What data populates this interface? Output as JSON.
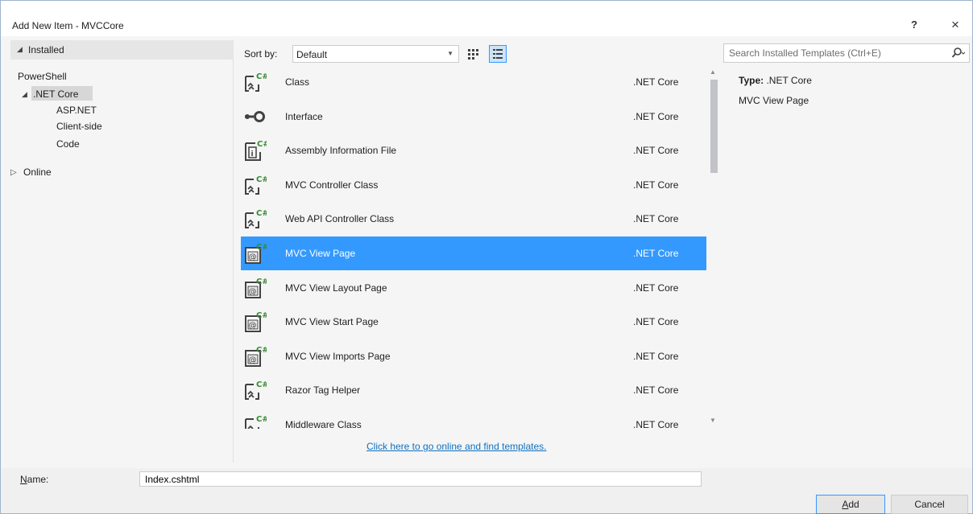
{
  "window": {
    "title": "Add New Item - MVCCore",
    "help_label": "?",
    "close_label": "×"
  },
  "tree": {
    "installed": "Installed",
    "installed_expanded_glyph": "◢",
    "items": [
      {
        "label": "PowerShell",
        "level": 1
      },
      {
        "label": ".NET Core",
        "level": 1,
        "selected": true,
        "expanded": true
      },
      {
        "label": "ASP.NET",
        "level": 2
      },
      {
        "label": "Client-side",
        "level": 2
      },
      {
        "label": "Code",
        "level": 2
      }
    ],
    "online": "Online",
    "online_glyph": "▷"
  },
  "toolbar": {
    "sort_label": "Sort by:",
    "sort_value": "Default"
  },
  "templates": [
    {
      "name": "Class",
      "type": ".NET Core",
      "icon": "csharp-class-icon"
    },
    {
      "name": "Interface",
      "type": ".NET Core",
      "icon": "interface-icon"
    },
    {
      "name": "Assembly Information File",
      "type": ".NET Core",
      "icon": "assembly-info-icon"
    },
    {
      "name": "MVC Controller Class",
      "type": ".NET Core",
      "icon": "csharp-class-icon"
    },
    {
      "name": "Web API Controller Class",
      "type": ".NET Core",
      "icon": "csharp-class-icon"
    },
    {
      "name": "MVC View Page",
      "type": ".NET Core",
      "icon": "razor-page-icon",
      "selected": true
    },
    {
      "name": "MVC View Layout Page",
      "type": ".NET Core",
      "icon": "razor-page-icon"
    },
    {
      "name": "MVC View Start Page",
      "type": ".NET Core",
      "icon": "razor-page-icon"
    },
    {
      "name": "MVC View Imports Page",
      "type": ".NET Core",
      "icon": "razor-page-icon"
    },
    {
      "name": "Razor Tag Helper",
      "type": ".NET Core",
      "icon": "csharp-class-icon"
    },
    {
      "name": "Middleware Class",
      "type": ".NET Core",
      "icon": "csharp-class-icon"
    }
  ],
  "online_link": "Click here to go online and find templates.",
  "search": {
    "placeholder": "Search Installed Templates (Ctrl+E)"
  },
  "details": {
    "type_label": "Type:",
    "type_value": ".NET Core",
    "description": "MVC View Page"
  },
  "footer": {
    "name_label": "Name:",
    "name_value": "Index.cshtml",
    "add_label": "Add",
    "cancel_label": "Cancel"
  },
  "colors": {
    "selection": "#3399ff",
    "link": "#0e70c0",
    "icon_green": "#388a34",
    "icon_dark": "#424242"
  }
}
